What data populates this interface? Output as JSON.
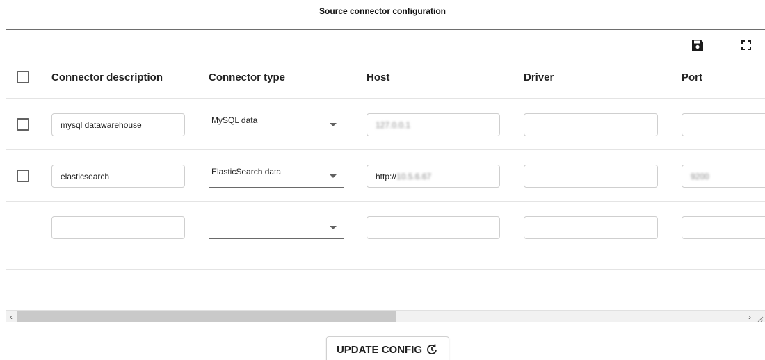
{
  "page": {
    "title": "Source connector configuration"
  },
  "toolbar": {
    "save_icon": "save-icon",
    "fullscreen_icon": "fullscreen-icon"
  },
  "table": {
    "columns": [
      "Connector description",
      "Connector type",
      "Host",
      "Driver",
      "Port"
    ],
    "rows": [
      {
        "description": "mysql datawarehouse",
        "type": "MySQL data",
        "host": "127.0.0.1",
        "driver": "",
        "port": ""
      },
      {
        "description": "elasticsearch",
        "type": "ElasticSearch data",
        "host_prefix": "http://",
        "host_blurred": "10.5.6.67",
        "driver": "",
        "port": "9200"
      },
      {
        "description": "",
        "type": "",
        "host": "",
        "driver": "",
        "port": ""
      }
    ]
  },
  "scrollbar": {
    "left_arrow": "‹",
    "right_arrow": "›",
    "thumb_fraction": 0.53
  },
  "actions": {
    "update_label": "UPDATE CONFIG",
    "update_icon": "refresh-icon"
  },
  "colors": {
    "text": "#212121",
    "border": "#cfcfcf",
    "divider": "#e4e4e4"
  }
}
